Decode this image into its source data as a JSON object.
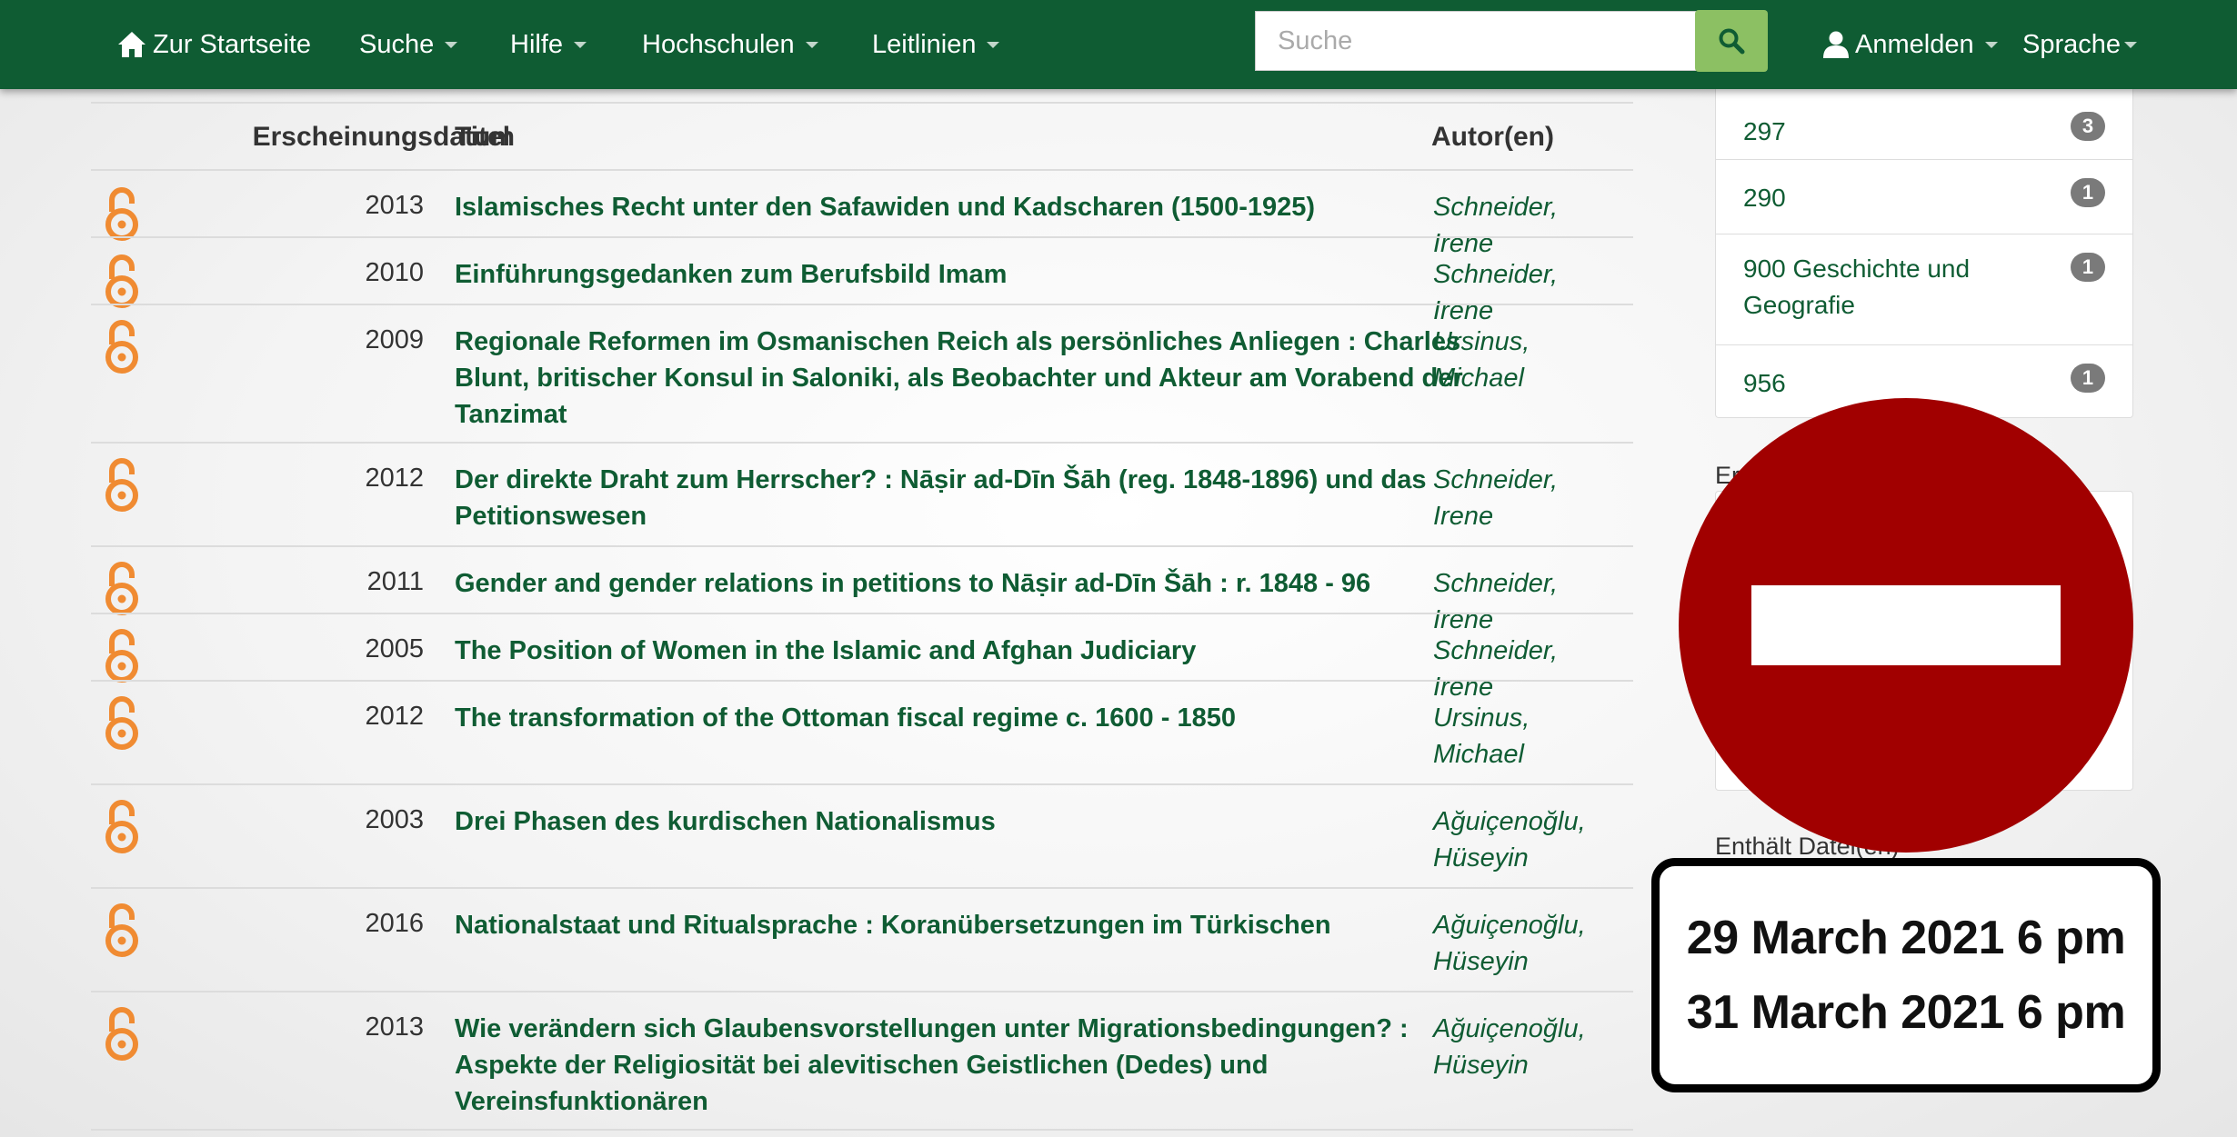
{
  "navbar": {
    "home_label": "Zur Startseite",
    "menus": [
      {
        "label": "Suche"
      },
      {
        "label": "Hilfe"
      },
      {
        "label": "Hochschulen"
      },
      {
        "label": "Leitlinien"
      }
    ],
    "search_placeholder": "Suche",
    "login_label": "Anmelden",
    "language_label": "Sprache"
  },
  "table": {
    "headers": {
      "date": "Erscheinungsdatum",
      "title": "Titel",
      "authors": "Autor(en)"
    },
    "rows": [
      {
        "year": "2013",
        "title": "Islamisches Recht unter den Safawiden und Kadscharen (1500-1925)",
        "author": "Schneider, Irene"
      },
      {
        "year": "2010",
        "title": "Einführungsgedanken zum Berufsbild Imam",
        "author": "Schneider, Irene"
      },
      {
        "year": "2009",
        "title": "Regionale Reformen im Osmanischen Reich als persönliches Anliegen : Charles Blunt, britischer Konsul in Saloniki, als Beobachter und Akteur am Vorabend der Tanzimat",
        "author": "Ursinus, Michael"
      },
      {
        "year": "2012",
        "title": "Der direkte Draht zum Herrscher? : Nāṣir ad-Dīn Šāh (reg. 1848-1896) und das Petitionswesen",
        "author": "Schneider, Irene"
      },
      {
        "year": "2011",
        "title": "Gender and gender relations in petitions to Nāṣir ad-Dīn Šāh : r. 1848 - 96",
        "author": "Schneider, Irene"
      },
      {
        "year": "2005",
        "title": "The Position of Women in the Islamic and Afghan Judiciary",
        "author": "Schneider, Irene"
      },
      {
        "year": "2012",
        "title": "The transformation of the Ottoman fiscal regime c. 1600 - 1850",
        "author": "Ursinus, Michael"
      },
      {
        "year": "2003",
        "title": "Drei Phasen des kurdischen Nationalismus",
        "author": "Ağuiçenoğlu, Hüseyin"
      },
      {
        "year": "2016",
        "title": "Nationalstaat und Ritualsprache : Koranübersetzungen im Türkischen",
        "author": "Ağuiçenoğlu, Hüseyin"
      },
      {
        "year": "2013",
        "title": "Wie verändern sich Glaubensvorstellungen unter Migrationsbedingungen? : Aspekte der Religiosität bei alevitischen Geistlichen (Dedes) und Vereinsfunktionären",
        "author": "Ağuiçenoğlu, Hüseyin"
      }
    ]
  },
  "sidebar": {
    "facets": [
      {
        "label": "297",
        "count": "3"
      },
      {
        "label": "290",
        "count": "1"
      },
      {
        "label": "900 Geschichte und Geografie",
        "count": "1"
      },
      {
        "label": "956",
        "count": "1"
      }
    ],
    "heading_partial": "Er",
    "files_heading": "Enthält Datei(en)"
  },
  "notice": {
    "line1": "29 March 2021 6 pm",
    "line2": "31 March 2021 6 pm"
  },
  "colors": {
    "brand_green": "#0f5c33",
    "search_button": "#8cc063",
    "open_access_orange": "#f08b32",
    "no_entry_red": "#a10000"
  }
}
